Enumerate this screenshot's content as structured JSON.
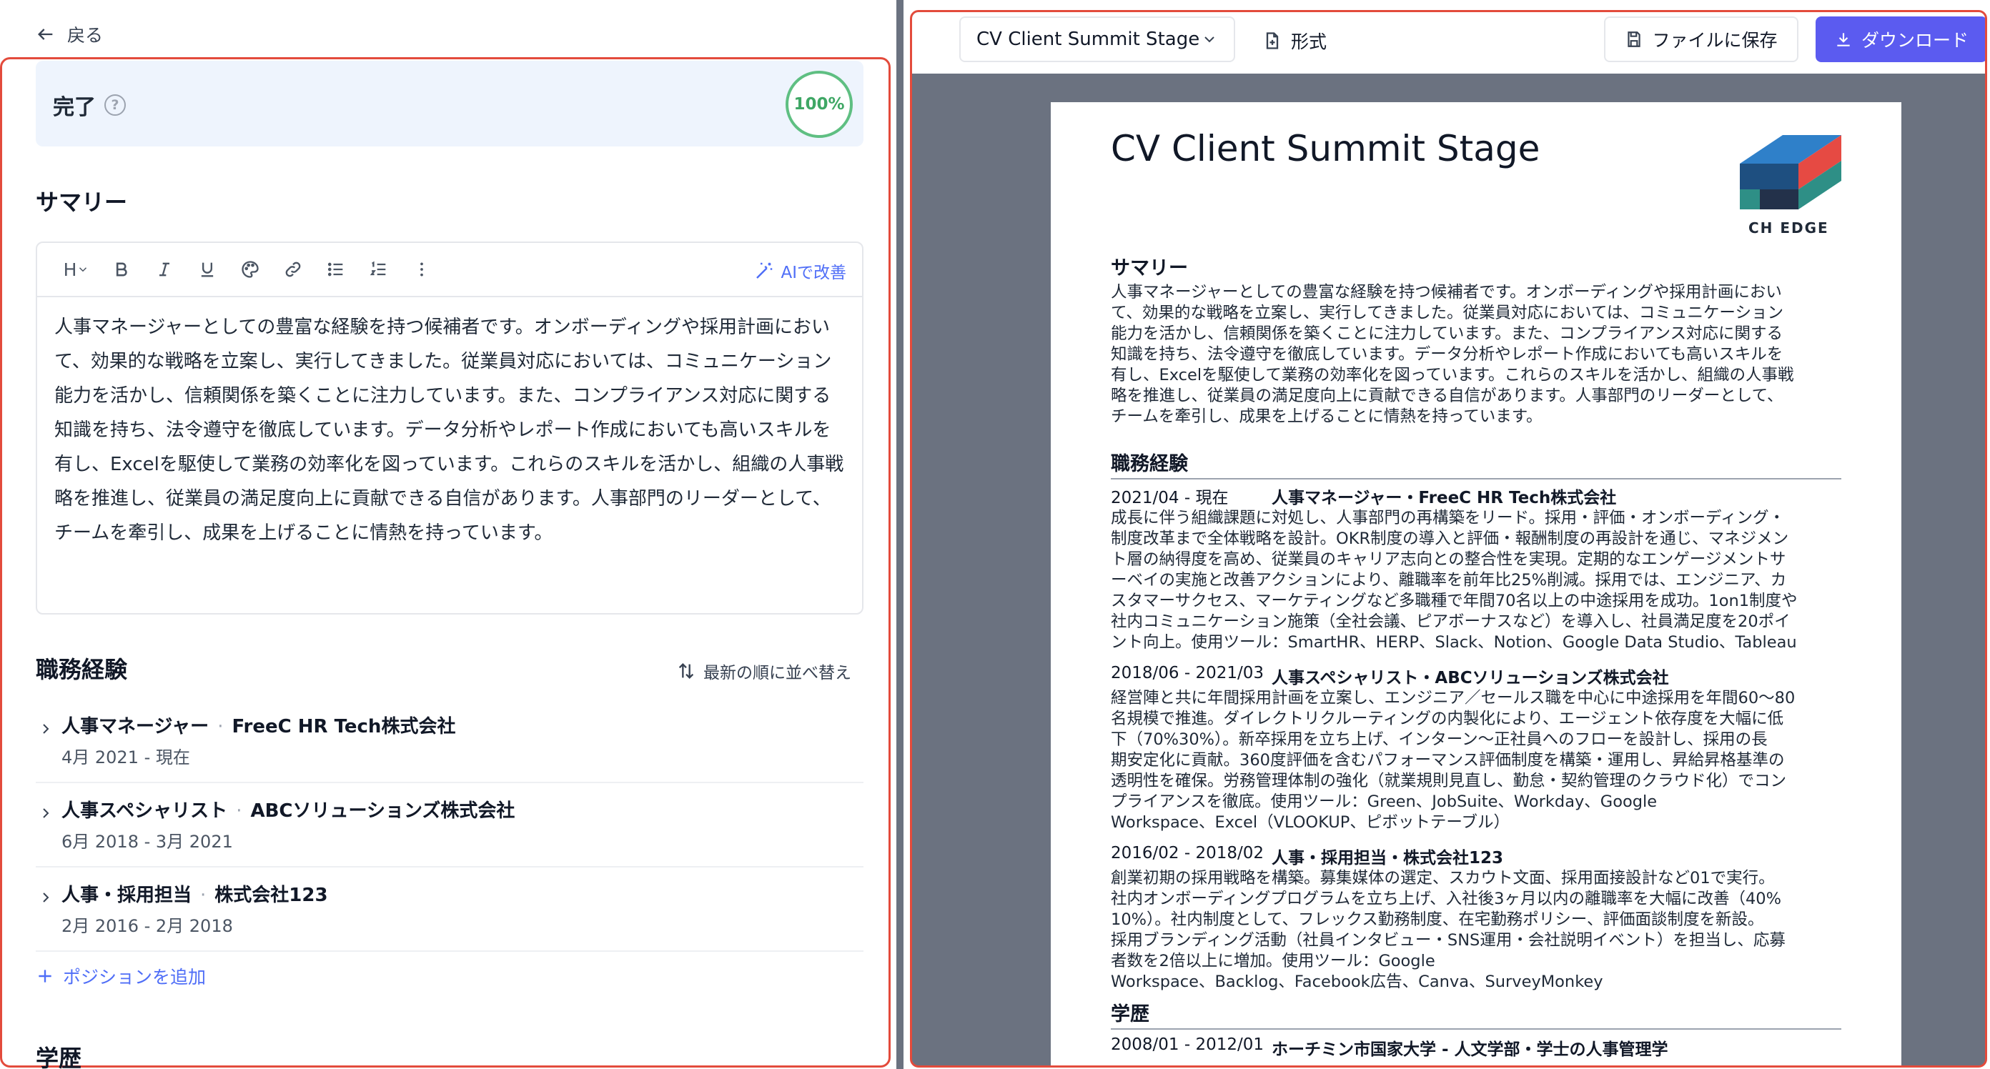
{
  "editor": {
    "back_label": "戻る",
    "complete_label": "完了",
    "progress": "100%",
    "summary_title": "サマリー",
    "toolbar": {
      "heading": "H",
      "ai_improve": "AIで改善"
    },
    "summary_text": "人事マネージャーとしての豊富な経験を持つ候補者です。オンボーディングや採用計画において、効果的な戦略を立案し、実行してきました。従業員対応においては、コミュニケーション能力を活かし、信頼関係を築くことに注力しています。また、コンプライアンス対応に関する知識を持ち、法令遵守を徹底しています。データ分析やレポート作成においても高いスキルを有し、Excelを駆使して業務の効率化を図っています。これらのスキルを活かし、組織の人事戦略を推進し、従業員の満足度向上に貢献できる自信があります。人事部門のリーダーとして、チームを牽引し、成果を上げることに情熱を持っています。",
    "experience_title": "職務経験",
    "sort_label": "最新の順に並べ替え",
    "jobs": [
      {
        "role": "人事マネージャー",
        "company": "FreeC HR Tech株式会社",
        "dates": "4月 2021 - 現在"
      },
      {
        "role": "人事スペシャリスト",
        "company": "ABCソリューションズ株式会社",
        "dates": "6月 2018 - 3月 2021"
      },
      {
        "role": "人事・採用担当",
        "company": "株式会社123",
        "dates": "2月 2016 - 2月 2018"
      }
    ],
    "add_position": "ポジションを追加",
    "education_title": "学歴"
  },
  "preview": {
    "template_name": "CV Client Summit Stage",
    "format_label": "形式",
    "save_label": "ファイルに保存",
    "download_label": "ダウンロード",
    "cv": {
      "name": "CV Client Summit Stage",
      "logo_text": "CH EDGE",
      "summary_heading": "サマリー",
      "summary_lines": [
        "人事マネージャーとしての豊富な経験を持つ候補者です。オンボーディングや採用計画におい",
        "て、効果的な戦略を立案し、実行してきました。従業員対応においては、コミュニケーション",
        "能力を活かし、信頼関係を築くことに注力しています。また、コンプライアンス対応に関する",
        "知識を持ち、法令遵守を徹底しています。データ分析やレポート作成においても高いスキルを",
        "有し、Excelを駆使して業務の効率化を図っています。これらのスキルを活かし、組織の人事戦",
        "略を推進し、従業員の満足度向上に貢献できる自信があります。人事部門のリーダーとして、",
        "チームを牽引し、成果を上げることに情熱を持っています。"
      ],
      "experience_heading": "職務経験",
      "jobs": [
        {
          "dates": "2021/04 - 現在",
          "title": "人事マネージャー・FreeC HR Tech株式会社",
          "lines": [
            "成長に伴う組織課題に対処し、人事部門の再構築をリード。採用・評価・オンボーディング・",
            "制度改革まで全体戦略を設計。OKR制度の導入と評価・報酬制度の再設計を通じ、マネジメン",
            "ト層の納得度を高め、従業員のキャリア志向との整合性を実現。定期的なエンゲージメントサ",
            "ーベイの実施と改善アクションにより、離職率を前年比25%削減。採用では、エンジニア、カ",
            "スタマーサクセス、マーケティングなど多職種で年間70名以上の中途採用を成功。1on1制度や",
            "社内コミュニケーション施策（全社会議、ピアボーナスなど）を導入し、社員満足度を20ポイ",
            "ント向上。使用ツール：SmartHR、HERP、Slack、Notion、Google Data Studio、Tableau"
          ]
        },
        {
          "dates": "2018/06 - 2021/03",
          "title": "人事スペシャリスト・ABCソリューションズ株式会社",
          "lines": [
            "経営陣と共に年間採用計画を立案し、エンジニア／セールス職を中心に中途採用を年間60〜80",
            "名規模で推進。ダイレクトリクルーティングの内製化により、エージェント依存度を大幅に低",
            "下（70%30%）。新卒採用を立ち上げ、インターン〜正社員へのフローを設計し、採用の長",
            "期安定化に貢献。360度評価を含むパフォーマンス評価制度を構築・運用し、昇給昇格基準の",
            "透明性を確保。労務管理体制の強化（就業規則見直し、勤怠・契約管理のクラウド化）でコン",
            "プライアンスを徹底。使用ツール：Green、JobSuite、Workday、Google",
            "Workspace、Excel（VLOOKUP、ピボットテーブル）"
          ]
        },
        {
          "dates": "2016/02 - 2018/02",
          "title": "人事・採用担当・株式会社123",
          "lines": [
            "創業初期の採用戦略を構築。募集媒体の選定、スカウト文面、採用面接設計など01で実行。",
            "社内オンボーディングプログラムを立ち上げ、入社後3ヶ月以内の離職率を大幅に改善（40%",
            "10%）。社内制度として、フレックス勤務制度、在宅勤務ポリシー、評価面談制度を新設。",
            "採用ブランディング活動（社員インタビュー・SNS運用・会社説明イベント）を担当し、応募",
            "者数を2倍以上に増加。使用ツール：Google",
            "Workspace、Backlog、Facebook広告、Canva、SurveyMonkey"
          ]
        }
      ],
      "education_heading": "学歴",
      "education": {
        "dates": "2008/01 - 2012/01",
        "title": "ホーチミン市国家大学 - 人文学部・学士の人事管理学"
      }
    }
  },
  "colors": {
    "accent": "#5b5bf0",
    "link": "#4f6ef7",
    "highlight_border": "#e34b3c",
    "progress_ring": "#5fbf82",
    "banner_bg": "#eef4fd",
    "preview_bg": "#6b7280"
  }
}
